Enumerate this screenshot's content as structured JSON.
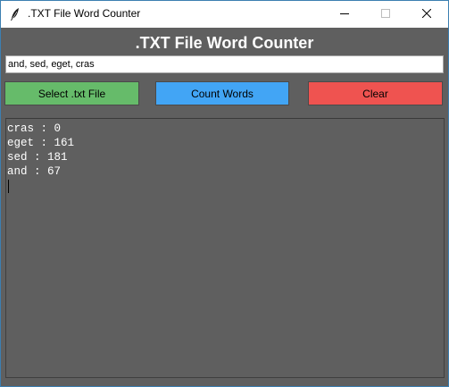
{
  "window": {
    "title": ".TXT File Word Counter",
    "icon": "feather-icon"
  },
  "app": {
    "heading": ".TXT File Word Counter",
    "input_value": "and, sed, eget, cras",
    "buttons": {
      "select_label": "Select .txt File",
      "count_label": "Count Words",
      "clear_label": "Clear"
    },
    "output_lines": [
      "cras : 0",
      "eget : 161",
      "sed : 181",
      "and : 67"
    ]
  },
  "colors": {
    "background": "#5f5f5f",
    "select_button": "#66bb6a",
    "count_button": "#42a5f5",
    "clear_button": "#ef5350",
    "text": "#ffffff"
  }
}
